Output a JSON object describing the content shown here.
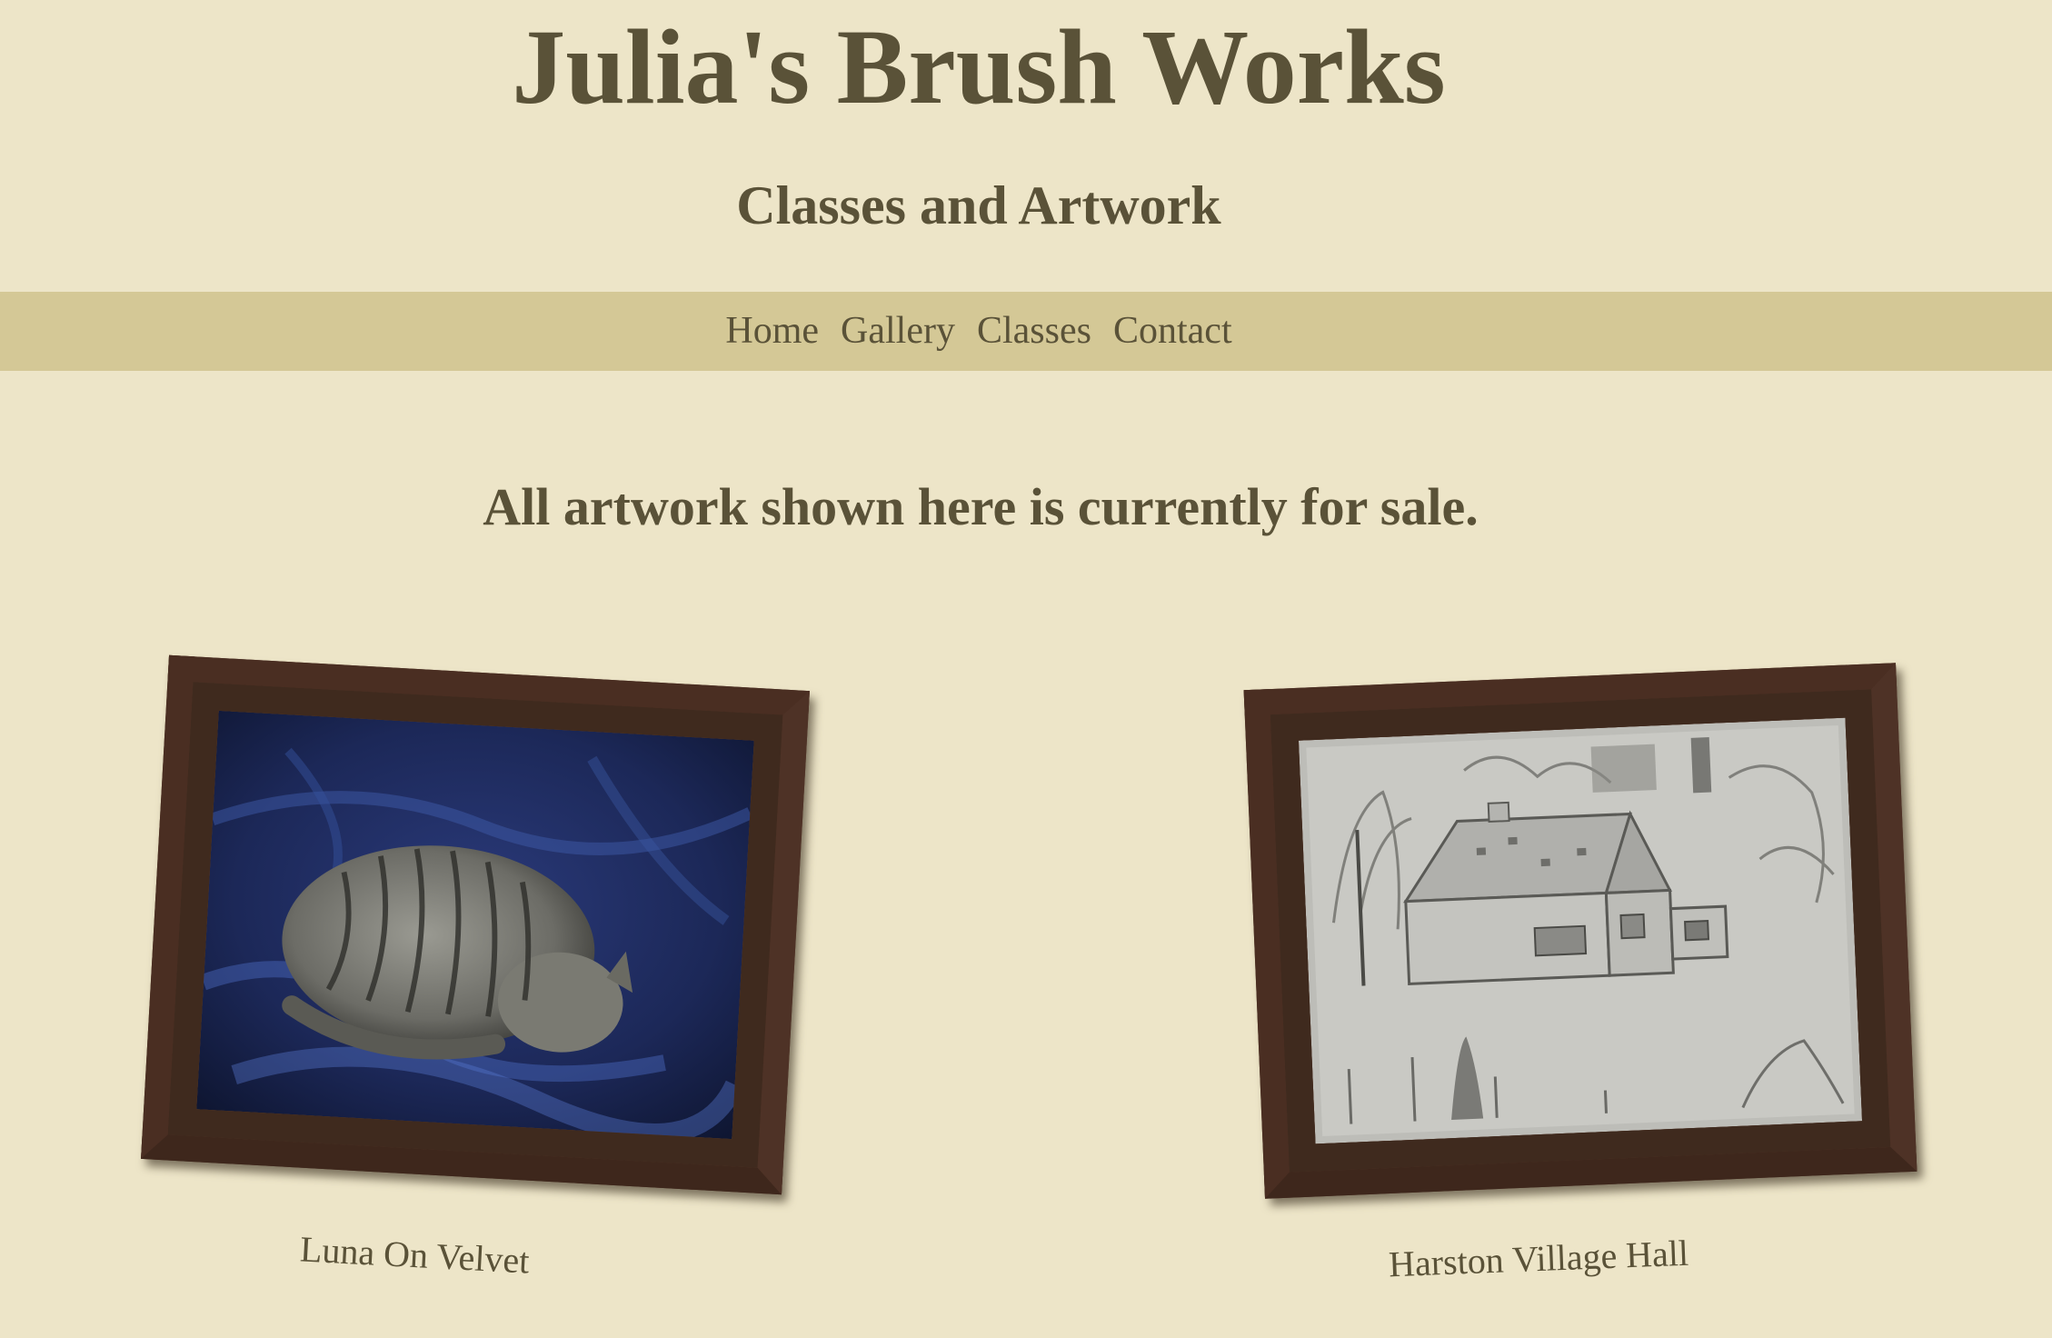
{
  "header": {
    "title": "Julia's Brush Works",
    "subtitle": "Classes and Artwork"
  },
  "nav": {
    "items": [
      {
        "label": "Home"
      },
      {
        "label": "Gallery"
      },
      {
        "label": "Classes"
      },
      {
        "label": "Contact"
      }
    ]
  },
  "main": {
    "notice": "All artwork shown here is currently for sale.",
    "artworks": [
      {
        "caption": "Luna On Velvet",
        "image_icon": "sleeping-tabby-cat-painting"
      },
      {
        "caption": "Harston Village Hall",
        "image_icon": "pencil-sketch-village-hall"
      }
    ]
  },
  "colors": {
    "background": "#ede5c8",
    "nav_background": "#d4c896",
    "text": "#5a5238",
    "frame": "#5a3a2c"
  }
}
